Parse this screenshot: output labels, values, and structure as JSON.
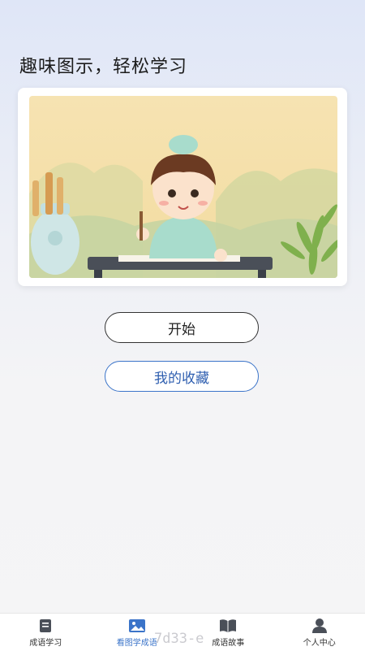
{
  "header": {
    "title": "趣味图示，轻松学习"
  },
  "banner": {
    "illustration": "child-writing-calligraphy-illustration"
  },
  "actions": {
    "start_label": "开始",
    "favorites_label": "我的收藏"
  },
  "tabbar": {
    "items": [
      {
        "label": "成语学习",
        "icon": "book-icon",
        "active": false
      },
      {
        "label": "看图学成语",
        "icon": "image-icon",
        "active": true
      },
      {
        "label": "成语故事",
        "icon": "open-book-icon",
        "active": false
      },
      {
        "label": "个人中心",
        "icon": "person-icon",
        "active": false
      }
    ]
  },
  "watermark": "7d33-e",
  "colors": {
    "accent": "#3b74c9",
    "text": "#1c1c1c"
  }
}
